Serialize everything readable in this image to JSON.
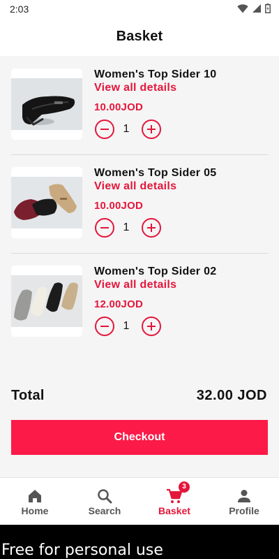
{
  "status_bar": {
    "time": "2:03",
    "icons": [
      "wifi-icon",
      "signal-icon",
      "battery-icon"
    ]
  },
  "header": {
    "title": "Basket"
  },
  "basket": {
    "details_label": "View all details",
    "items": [
      {
        "name": "Women's Top Sider 10",
        "price": "10.00JOD",
        "quantity": "1",
        "image": "black-loafer-shoe"
      },
      {
        "name": "Women's Top Sider 05",
        "price": "10.00JOD",
        "quantity": "1",
        "image": "burgundy-black-beige-loafers"
      },
      {
        "name": "Women's Top Sider 02",
        "price": "12.00JOD",
        "quantity": "1",
        "image": "silver-black-white-beige-loafers"
      }
    ]
  },
  "summary": {
    "total_label": "Total",
    "total_value": "32.00 JOD"
  },
  "checkout": {
    "label": "Checkout"
  },
  "nav": {
    "items": [
      {
        "label": "Home",
        "icon": "home-icon"
      },
      {
        "label": "Search",
        "icon": "search-icon"
      },
      {
        "label": "Basket",
        "icon": "cart-icon",
        "badge": "3",
        "active": true
      },
      {
        "label": "Profile",
        "icon": "person-icon"
      }
    ]
  },
  "watermark": {
    "text": "Free for personal use"
  },
  "colors": {
    "accent": "#e4163b",
    "checkout_bg": "#fc1a48",
    "background": "#f5f5f5"
  }
}
